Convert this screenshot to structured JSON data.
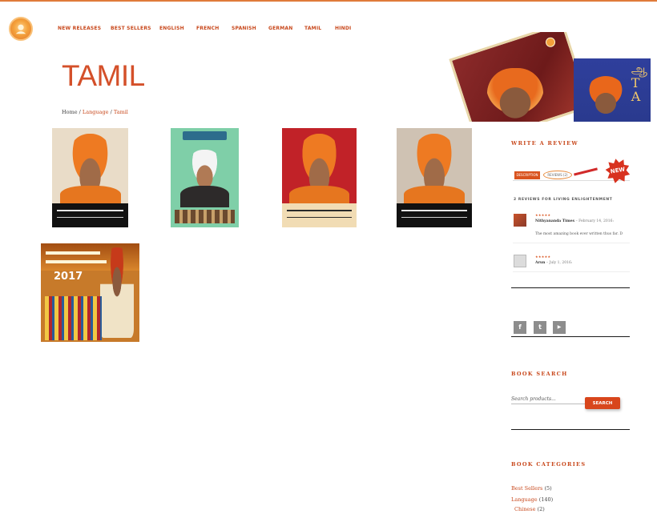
{
  "nav": [
    {
      "label": "NEW RELEASES"
    },
    {
      "label": "BEST SELLERS"
    },
    {
      "label": "ENGLISH"
    },
    {
      "label": "FRENCH"
    },
    {
      "label": "SPANISH"
    },
    {
      "label": "GERMAN"
    },
    {
      "label": "TAMIL"
    },
    {
      "label": "HINDI"
    }
  ],
  "page": {
    "title": "TAMIL"
  },
  "breadcrumb": {
    "home": "Home",
    "sep": " / ",
    "language": "Language",
    "current": "Tamil"
  },
  "products": [
    {
      "cover_icon": "book-cover-image",
      "colors": {
        "bg": "#e9dcc8"
      }
    },
    {
      "cover_icon": "book-cover-image",
      "colors": {
        "bg": "#7fcfa8"
      }
    },
    {
      "cover_icon": "book-cover-image",
      "colors": {
        "bg": "#c12228"
      }
    },
    {
      "cover_icon": "book-cover-image",
      "colors": {
        "bg": "#cfc2b3"
      }
    },
    {
      "cover_icon": "calendar-cover-image",
      "year": "2017",
      "colors": {
        "bg": "#c77a2a"
      }
    }
  ],
  "sidebar": {
    "write_review": {
      "title": "WRITE A REVIEW",
      "tab_description": "DESCRIPTION",
      "tab_reviews": "REVIEWS (2)",
      "badge": "NEW",
      "heading": "2 REVIEWS FOR LIVING ENLIGHTENMENT",
      "reviews": [
        {
          "stars": "★★★★★",
          "author": "Nithyananda Times",
          "date": "– February 14, 2016:",
          "text": "The most amazing book ever written thus far. D"
        },
        {
          "stars": "★★★★★",
          "author": "Arun",
          "date": "– July 1, 2016:",
          "text": ""
        }
      ]
    },
    "social": [
      {
        "label": "f",
        "icon": "facebook-icon"
      },
      {
        "label": "t",
        "icon": "twitter-icon"
      },
      {
        "label": "▶",
        "icon": "youtube-icon"
      }
    ],
    "book_search": {
      "title": "BOOK SEARCH",
      "placeholder": "Search products...",
      "button": "SEARCH"
    },
    "categories": {
      "title": "BOOK CATEGORIES",
      "items": [
        {
          "label": "Best Sellers",
          "count": "(5)"
        },
        {
          "label": "Language",
          "count": "(140)"
        },
        {
          "label": "Chinese",
          "count": "(2)"
        }
      ]
    }
  },
  "colors": {
    "accent": "#c8481c",
    "title": "#d4502a",
    "button": "#d8461c"
  }
}
